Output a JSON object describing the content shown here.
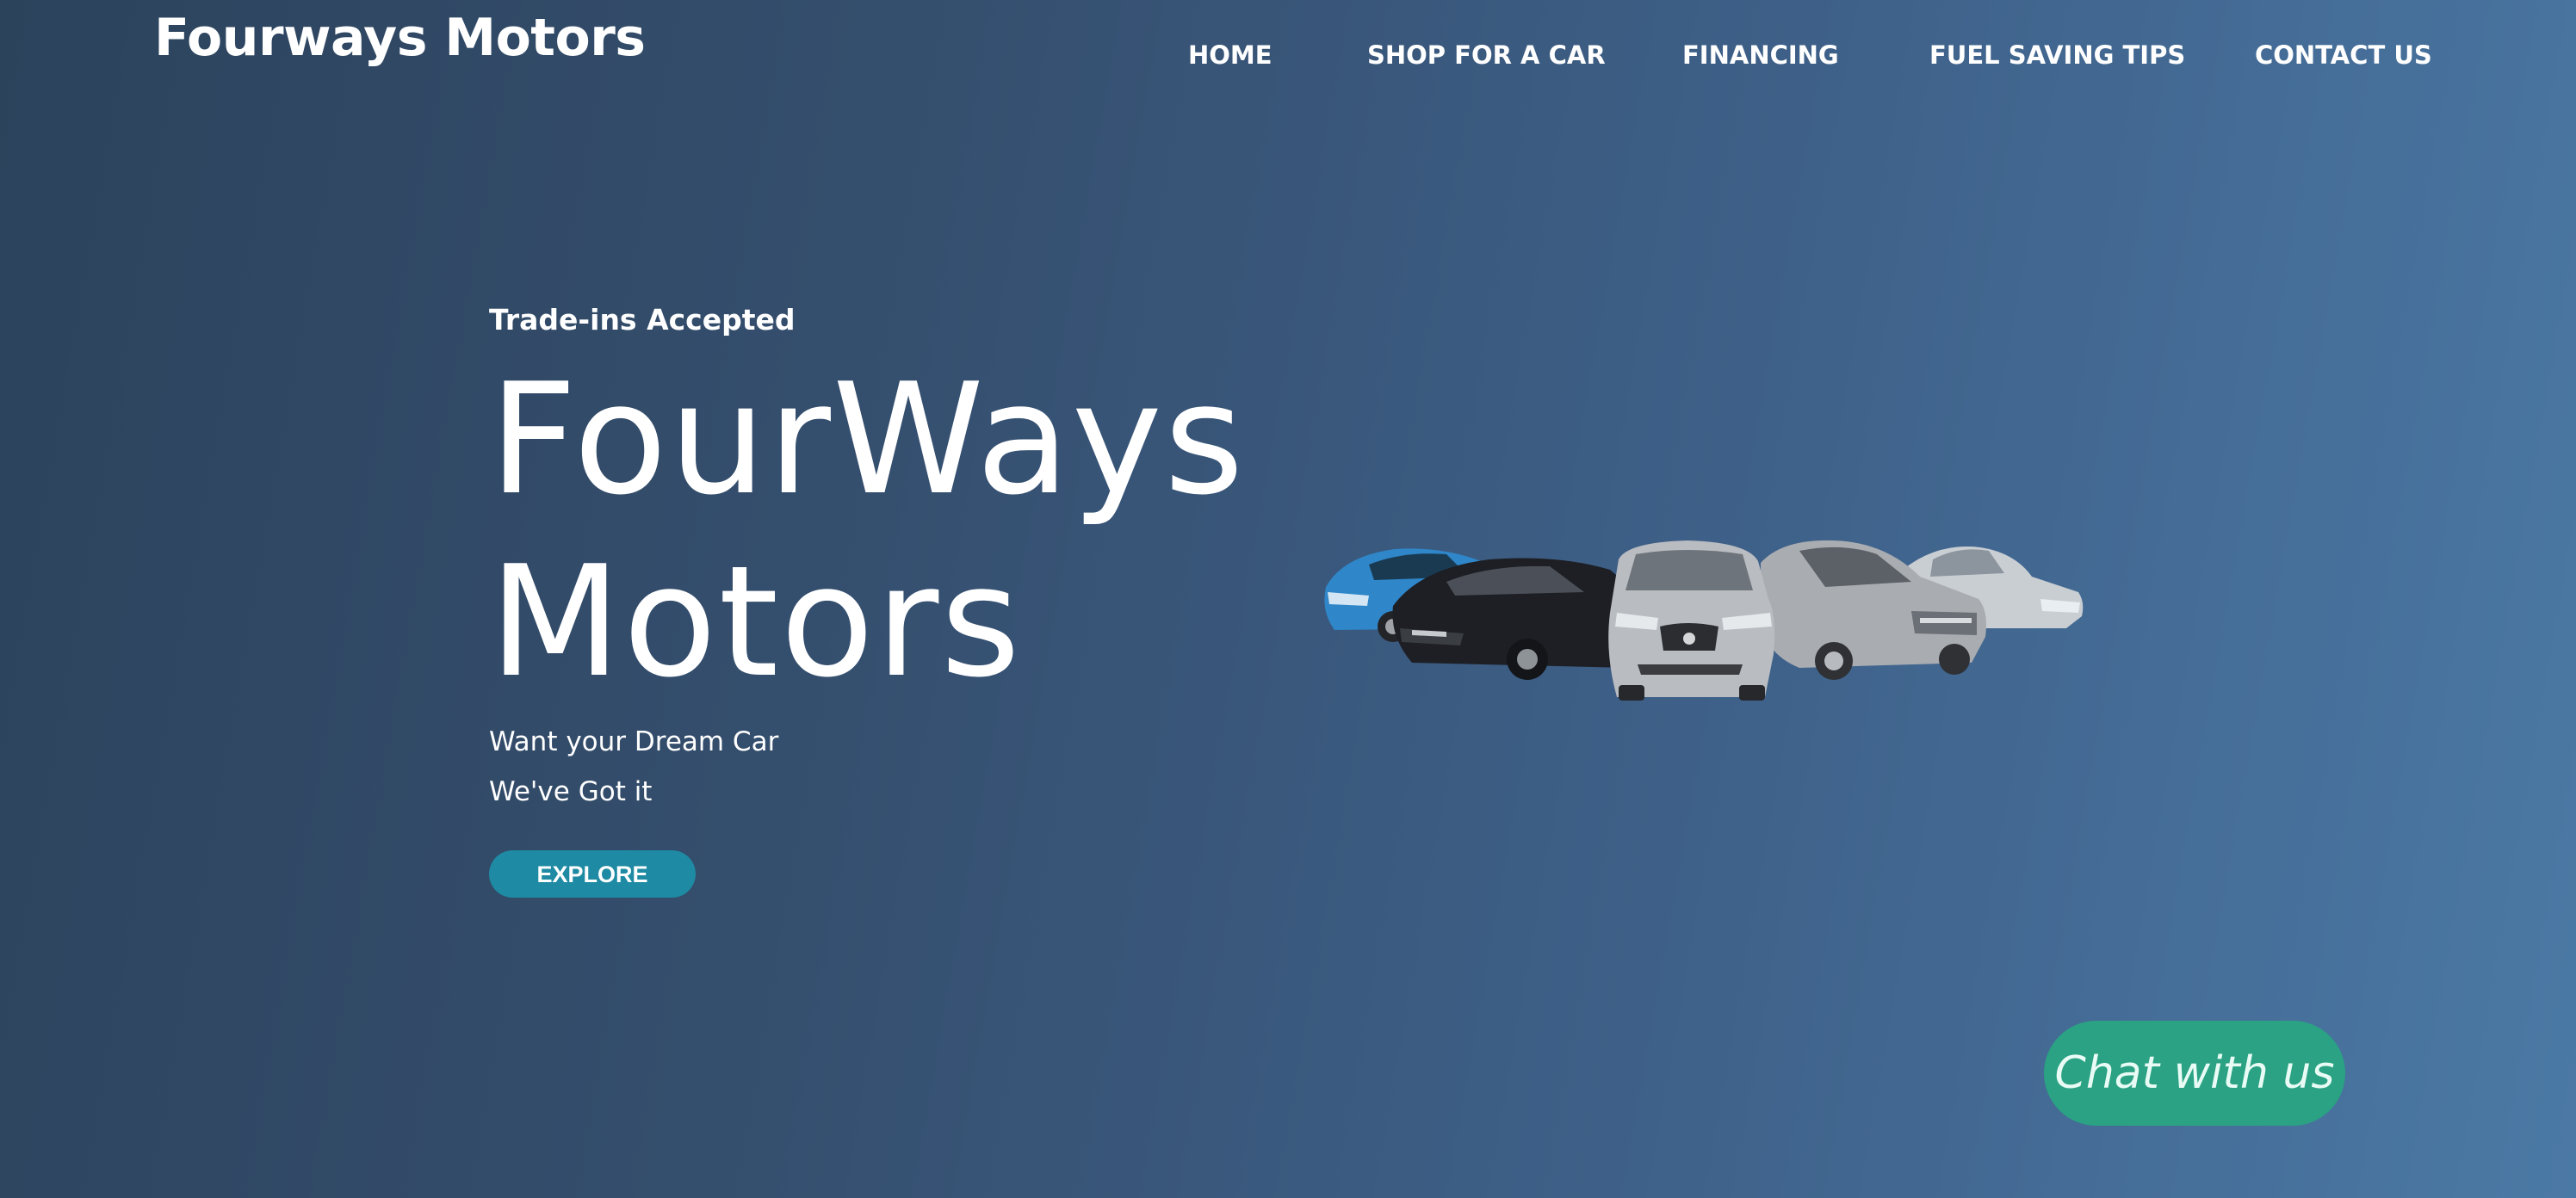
{
  "header": {
    "brand": "Fourways Motors"
  },
  "nav": {
    "items": [
      {
        "label": "HOME"
      },
      {
        "label": "SHOP FOR A CAR"
      },
      {
        "label": "FINANCING"
      },
      {
        "label": "FUEL SAVING TIPS"
      },
      {
        "label": "CONTACT US"
      }
    ]
  },
  "hero": {
    "eyebrow": "Trade-ins Accepted",
    "title_line1": "FourWays",
    "title_line2": "Motors",
    "subline1": "Want your Dream Car",
    "subline2": "We've Got it",
    "cta_label": "EXPLORE",
    "cta_color": "#1e8aa3"
  },
  "image": {
    "subject": "lineup-of-five-cars",
    "car_colors": [
      "#2f86c9",
      "#1d1f24",
      "#b9bcc0",
      "#a9acb0",
      "#c9ced3"
    ]
  },
  "chat": {
    "label": "Chat with us",
    "color": "#2aa283"
  }
}
